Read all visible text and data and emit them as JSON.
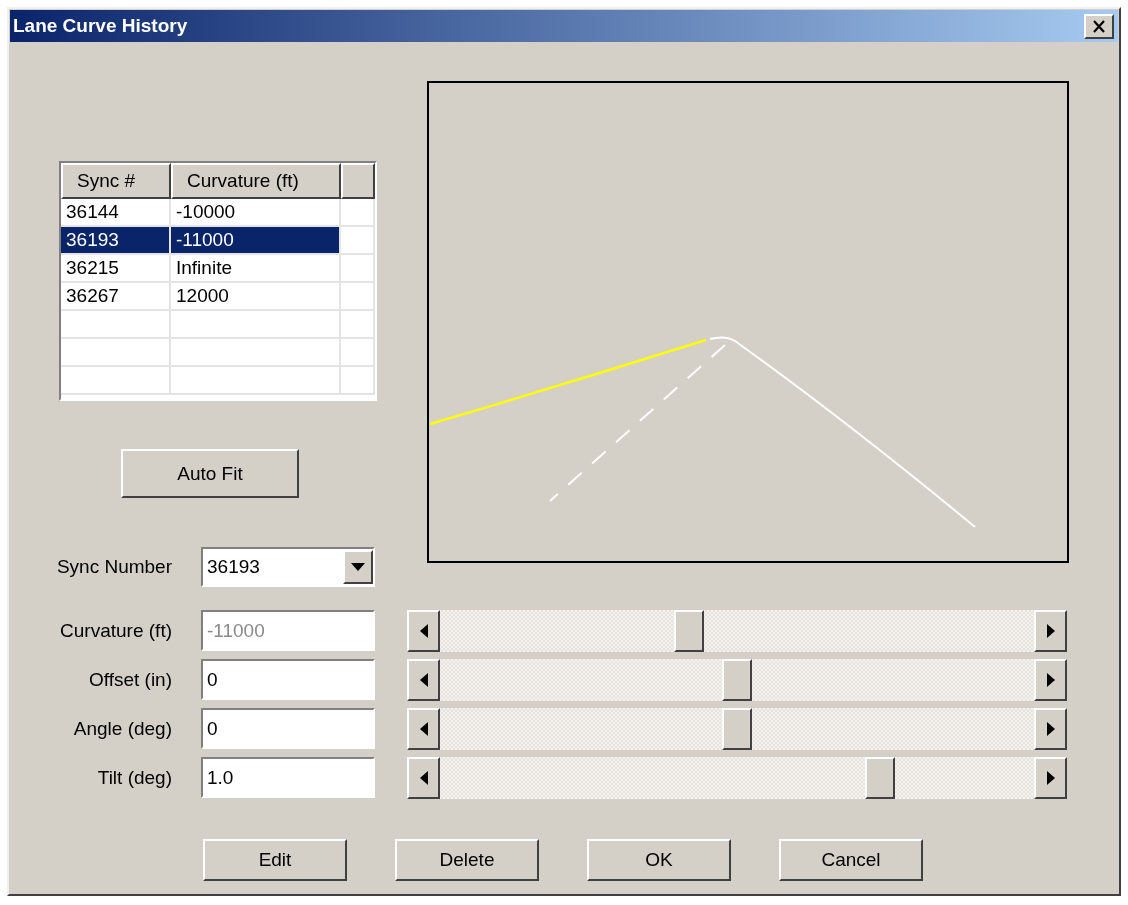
{
  "window": {
    "title": "Lane Curve History"
  },
  "table": {
    "columns": [
      "Sync #",
      "Curvature (ft)"
    ],
    "rows": [
      {
        "sync": "36144",
        "curvature": "-10000",
        "selected": false
      },
      {
        "sync": "36193",
        "curvature": "-11000",
        "selected": true
      },
      {
        "sync": "36215",
        "curvature": "Infinite",
        "selected": false
      },
      {
        "sync": "36267",
        "curvature": "12000",
        "selected": false
      }
    ]
  },
  "auto_fit": {
    "label": "Auto Fit"
  },
  "sync_number": {
    "label": "Sync Number",
    "value": "36193"
  },
  "params": [
    {
      "label": "Curvature (ft)",
      "value": "-11000",
      "disabled": true,
      "level": 0.42
    },
    {
      "label": "Offset (in)",
      "value": "0",
      "disabled": false,
      "level": 0.5
    },
    {
      "label": "Angle (deg)",
      "value": "0",
      "disabled": false,
      "level": 0.5
    },
    {
      "label": "Tilt (deg)",
      "value": "1.0",
      "disabled": false,
      "level": 0.74
    }
  ],
  "buttons": [
    "Edit",
    "Delete",
    "OK",
    "Cancel"
  ]
}
